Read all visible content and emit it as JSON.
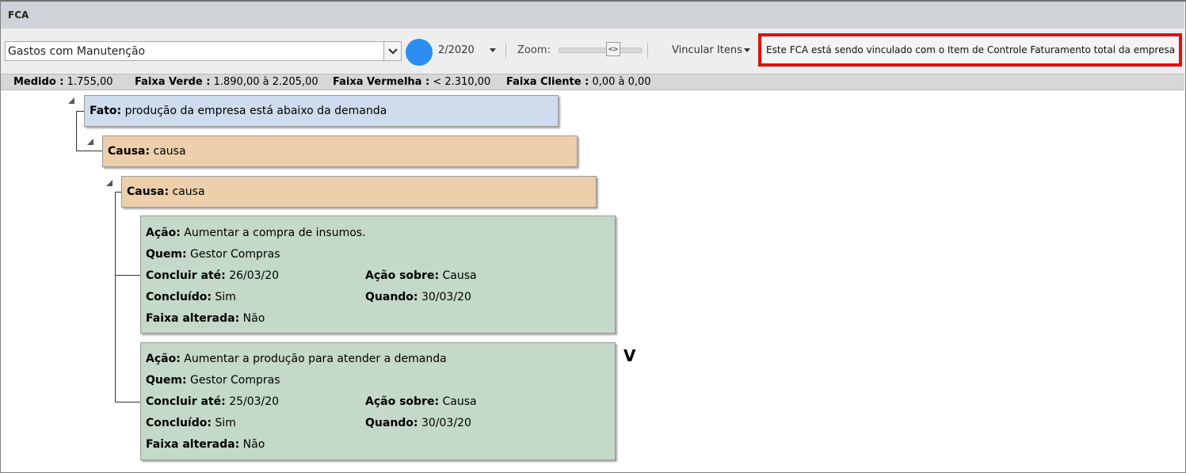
{
  "window": {
    "title": "FCA"
  },
  "toolbar": {
    "indicator_value": "Gastos com Manutenção",
    "dropdown_icon": "chevron-down-icon",
    "status_color": "#2b8ef0",
    "period": "2/2020",
    "zoom_label": "Zoom:",
    "zoom_icon": "<>",
    "vincular_label": "Vincular Itens",
    "notice": "Este FCA está sendo vinculado com o Item de Controle Faturamento total da empresa"
  },
  "info": {
    "medido_label": "Medido :",
    "medido_value": "1.755,00",
    "verde_label": "Faixa Verde :",
    "verde_value": "1.890,00 à 2.205,00",
    "vermelha_label": "Faixa Vermelha :",
    "vermelha_value": "< 2.310,00",
    "cliente_label": "Faixa Cliente :",
    "cliente_value": "0,00 à 0,00"
  },
  "tree": {
    "fato": {
      "label": "Fato:",
      "text": "produção da empresa está abaixo da demanda"
    },
    "causa1": {
      "label": "Causa:",
      "text": "causa"
    },
    "causa2": {
      "label": "Causa:",
      "text": "causa"
    },
    "acoes": [
      {
        "acao_label": "Ação:",
        "acao": "Aumentar a compra de insumos.",
        "quem_label": "Quem:",
        "quem": "Gestor Compras",
        "concluir_label": "Concluir até:",
        "concluir": "26/03/20",
        "sobre_label": "Ação sobre:",
        "sobre": "Causa",
        "concluido_label": "Concluído:",
        "concluido": "Sim",
        "quando_label": "Quando:",
        "quando": "30/03/20",
        "faixa_label": "Faixa alterada:",
        "faixa": "Não"
      },
      {
        "acao_label": "Ação:",
        "acao": "Aumentar a produção para atender a demanda",
        "quem_label": "Quem:",
        "quem": "Gestor Compras",
        "concluir_label": "Concluir até:",
        "concluir": "25/03/20",
        "sobre_label": "Ação sobre:",
        "sobre": "Causa",
        "concluido_label": "Concluído:",
        "concluido": "Sim",
        "quando_label": "Quando:",
        "quando": "30/03/20",
        "faixa_label": "Faixa alterada:",
        "faixa": "Não"
      }
    ],
    "verified_mark": "V"
  }
}
